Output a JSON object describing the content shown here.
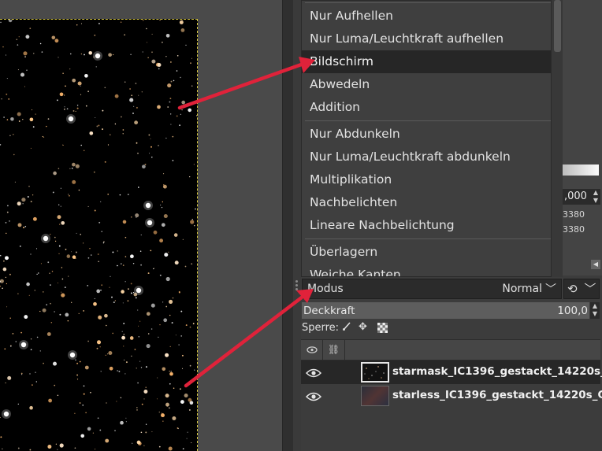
{
  "menu": {
    "items": [
      {
        "label": "Nur Aufhellen",
        "active": false
      },
      {
        "label": "Nur Luma/Leuchtkraft aufhellen",
        "active": false
      },
      {
        "label": "Bildschirm",
        "active": true
      },
      {
        "label": "Abwedeln",
        "active": false
      },
      {
        "label": "Addition",
        "active": false
      },
      {
        "label": "Nur Abdunkeln",
        "active": false
      },
      {
        "label": "Nur Luma/Leuchtkraft abdunkeln",
        "active": false
      },
      {
        "label": "Multiplikation",
        "active": false
      },
      {
        "label": "Nachbelichten",
        "active": false
      },
      {
        "label": "Lineare Nachbelichtung",
        "active": false
      },
      {
        "label": "Überlagern",
        "active": false
      },
      {
        "label": "Weiche Kanten",
        "active": false
      }
    ]
  },
  "background_panel": {
    "spin_value": ",000",
    "num_1": "3380",
    "num_2": "3380"
  },
  "layers": {
    "mode_label": "Modus",
    "mode_value": "Normal",
    "opacity_label": "Deckkraft",
    "opacity_value": "100,0",
    "lock_label": "Sperre:",
    "items": [
      {
        "name": "starmask_IC1396_gestackt_14220s_",
        "selected": true,
        "visible": true
      },
      {
        "name": "starless_IC1396_gestackt_14220s_G",
        "selected": false,
        "visible": true
      }
    ]
  },
  "colors": {
    "arrow": "#e0223a",
    "selection": "#d6c640"
  }
}
